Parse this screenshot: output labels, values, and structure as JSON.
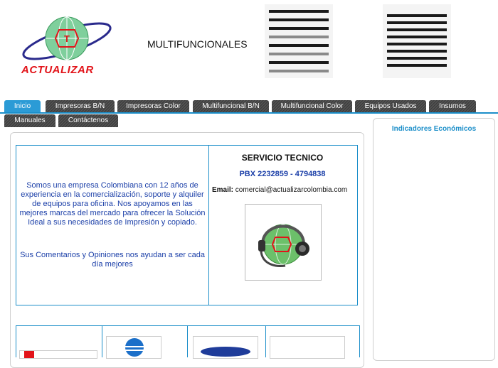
{
  "header": {
    "brand_name": "ACTUALIZAR",
    "title": "MULTIFUNCIONALES"
  },
  "nav": {
    "tabs": [
      {
        "label": "Inicio",
        "active": true
      },
      {
        "label": "Impresoras B/N"
      },
      {
        "label": "Impresoras Color"
      },
      {
        "label": "Multifuncional B/N"
      },
      {
        "label": "Multifuncional Color"
      },
      {
        "label": "Equipos Usados"
      },
      {
        "label": "Insumos"
      },
      {
        "label": "Manuales"
      },
      {
        "label": "Contáctenos"
      }
    ]
  },
  "intro": {
    "paragraph1": "Somos una empresa Colombiana con 12 años de experiencia en la comercialización, soporte y alquiler de equipos para oficina. Nos apoyamos en las mejores marcas del mercado para ofrecer la Solución Ideal a sus necesidades de Impresión y copiado.",
    "paragraph2": "Sus Comentarios y Opiniones nos ayudan a ser cada día mejores"
  },
  "service": {
    "title": "SERVICIO TECNICO",
    "pbx": "PBX 2232859 - 4794838",
    "email_label": "Email:",
    "email_value": "comercial@actualizarcolombia.com"
  },
  "sidebar": {
    "title": "Indicadores Económicos"
  },
  "colors": {
    "accent": "#1b8ec9",
    "brand_red": "#e2141a",
    "text_blue": "#1b3fa8",
    "tab_dark": "#4a4a4a"
  }
}
